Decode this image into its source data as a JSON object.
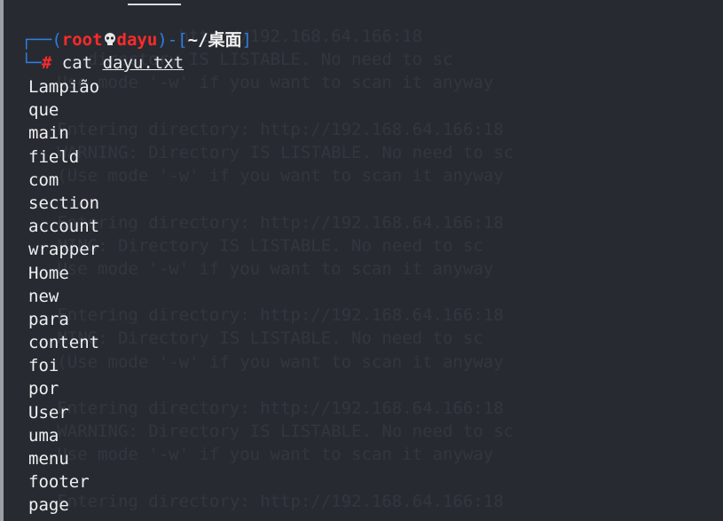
{
  "prompt": {
    "corner_top": "┌──(",
    "user": "root",
    "skull_icon": "skull-icon",
    "host": "dayu",
    "close_paren": ")-[",
    "path": "~/桌面",
    "close_bracket": "]",
    "corner_bottom": "└─",
    "hash": "#",
    "command": "cat",
    "argument": "dayu.txt"
  },
  "output_lines": [
    "Lampião",
    "que",
    "main",
    "field",
    "com",
    "section",
    "account",
    "wrapper",
    "Home",
    "new",
    "para",
    "content",
    "foi",
    "por",
    "User",
    "uma",
    "menu",
    "footer",
    "page"
  ],
  "ghost_lines": [
    "               http://192.168.64.166:18",
    "      directory IS LISTABLE. No need to sc",
    "   Use mode '-w' if you want to scan it anyway",
    "",
    "   Entering directory: http://192.168.64.166:18",
    "   WARNING: Directory IS LISTABLE. No need to sc",
    "   (Use mode '-w' if you want to scan it anyway",
    "",
    "   Entering directory: http://192.168.64.166:18",
    "   NING: Directory IS LISTABLE. No need to sc",
    "   Use mode '-w' if you want to scan it anyway",
    "",
    "   Entering directory: http://192.168.64.166:18",
    "   NING: Directory IS LISTABLE. No need to sc",
    "   (Use mode '-w' if you want to scan it anyway",
    "",
    "   Entering directory: http://192.168.64.166:18",
    "   WARNING: Directory IS LISTABLE. No need to sc",
    "   Use mode '-w' if you want to scan it anyway",
    "",
    "   Entering directory: http://192.168.64.166:18"
  ],
  "colors": {
    "background": "#272b31",
    "prompt_blue": "#2f7de1",
    "prompt_red": "#ff2a2a",
    "text": "#eef0f2"
  }
}
